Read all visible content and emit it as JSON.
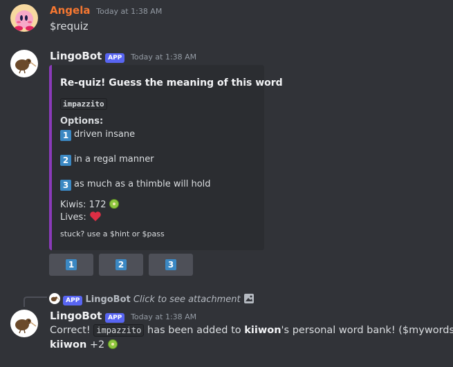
{
  "messages": [
    {
      "author": "Angela",
      "author_color": "#f57731",
      "timestamp": "Today at 1:38 AM",
      "content": "$requiz"
    },
    {
      "author": "LingoBot",
      "badge": "APP",
      "timestamp": "Today at 1:38 AM",
      "embed": {
        "accent_color": "#8a3ab9",
        "title": "Re-quiz! Guess the meaning of this word",
        "word": "impazzito",
        "options_label": "Options:",
        "options": [
          {
            "num": "1",
            "text": "driven insane"
          },
          {
            "num": "2",
            "text": "in a regal manner"
          },
          {
            "num": "3",
            "text": "as much as a thimble will hold"
          }
        ],
        "kiwis_label": "Kiwis: 172",
        "lives_label": "Lives:",
        "footer": "stuck? use a $hint or $pass"
      },
      "buttons": [
        "1",
        "2",
        "3"
      ]
    },
    {
      "reply": {
        "badge": "APP",
        "author": "LingoBot",
        "text": "Click to see attachment"
      },
      "author": "LingoBot",
      "badge": "APP",
      "timestamp": "Today at 1:38 AM",
      "line1": {
        "pre": "Correct!",
        "code": "impazzito",
        "mid": "has been added to",
        "user": "kiiwon",
        "post": "'s personal word bank! ($mywords)"
      },
      "line2": {
        "user": "kiiwon",
        "text": "+2"
      }
    }
  ]
}
